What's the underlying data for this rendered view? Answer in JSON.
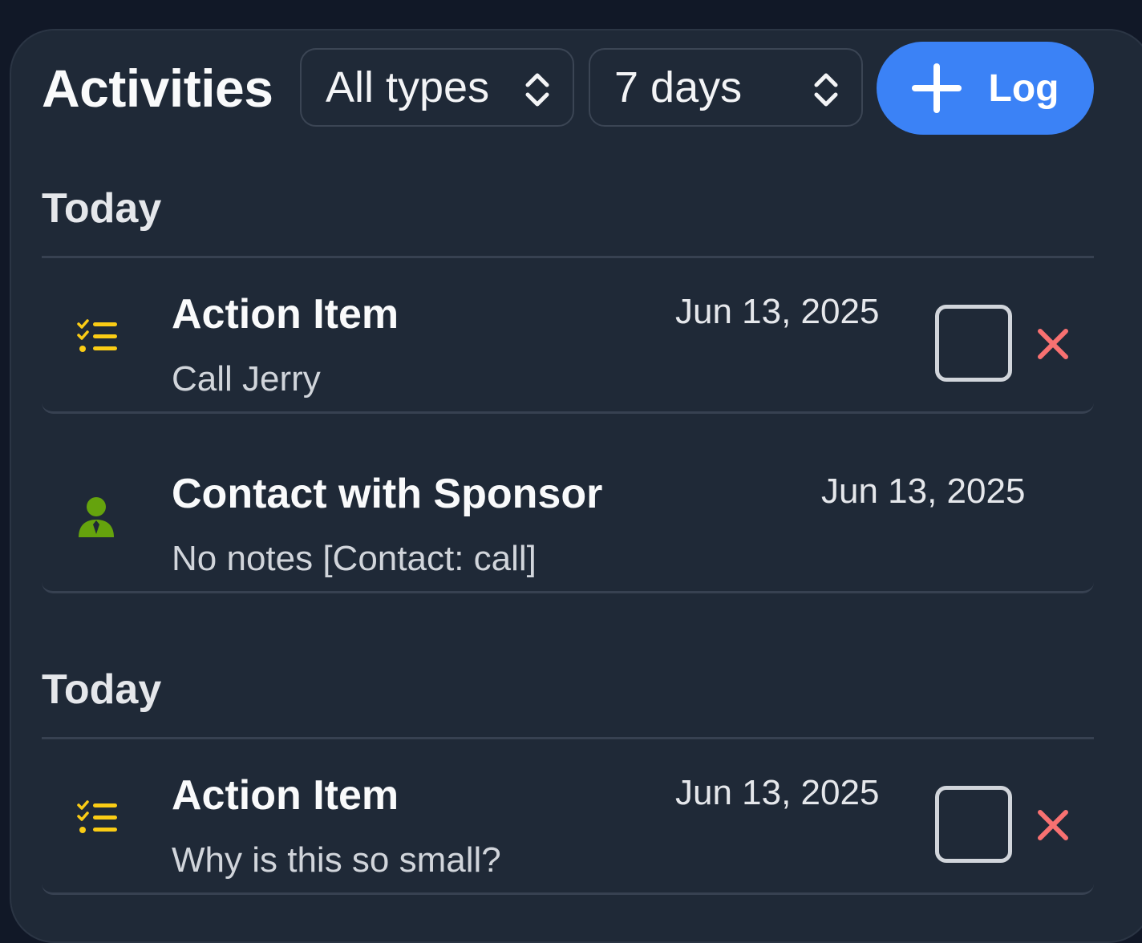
{
  "header": {
    "title": "Activities",
    "type_filter": "All types",
    "range_filter": "7 days",
    "log_button": "Log"
  },
  "colors": {
    "accent": "#3b82f6",
    "action_icon": "#facc15",
    "contact_icon": "#65a30d",
    "delete": "#f87171"
  },
  "groups": [
    {
      "heading": "Today",
      "items": [
        {
          "icon": "checklist-icon",
          "title": "Action Item",
          "subtitle": "Call Jerry",
          "date": "Jun 13, 2025",
          "has_checkbox": true,
          "checked": false
        },
        {
          "icon": "person-icon",
          "title": "Contact with Sponsor",
          "subtitle": "No notes [Contact: call]",
          "date": "Jun 13, 2025",
          "has_checkbox": false
        }
      ]
    },
    {
      "heading": "Today",
      "items": [
        {
          "icon": "checklist-icon",
          "title": "Action Item",
          "subtitle": "Why is this so small?",
          "date": "Jun 13, 2025",
          "has_checkbox": true,
          "checked": false
        }
      ]
    }
  ]
}
